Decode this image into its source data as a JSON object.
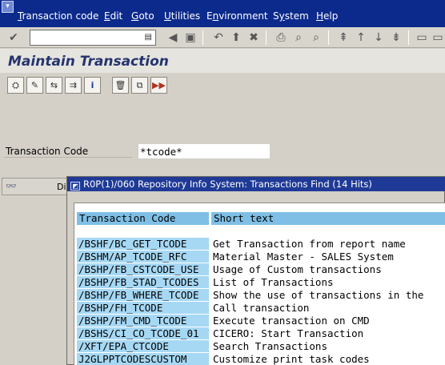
{
  "menu": {
    "items": [
      {
        "label": "Transaction code",
        "ul": "T"
      },
      {
        "label": "Edit",
        "ul": "E"
      },
      {
        "label": "Goto",
        "ul": "G"
      },
      {
        "label": "Utilities",
        "ul": "U"
      },
      {
        "label": "Environment",
        "ul": "n"
      },
      {
        "label": "System",
        "ul": "y"
      },
      {
        "label": "Help",
        "ul": "H"
      }
    ]
  },
  "toolbar": {
    "command_value": "",
    "buttons": [
      "enter-icon",
      "save-icon",
      "back-icon",
      "exit-icon",
      "cancel-icon",
      "print-icon",
      "find-icon",
      "find-next-icon",
      "first-page-icon",
      "prev-page-icon",
      "next-page-icon",
      "last-page-icon",
      "create-session-icon"
    ]
  },
  "title": "Maintain Transaction",
  "app_toolbar": [
    "display-icon",
    "change-icon",
    "variants-icon",
    "object-list-icon",
    "info-icon",
    "delete-icon",
    "copy-icon",
    "other-object-icon"
  ],
  "field": {
    "label": "Transaction Code",
    "value": "*tcode*"
  },
  "left_tab": {
    "label": "Di"
  },
  "popup": {
    "title": "R0P(1)/060 Repository Info System: Transactions Find (14 Hits)",
    "headers": [
      "Transaction Code",
      "Short text"
    ],
    "rows": [
      {
        "code": "/BSHF/BC_GET_TCODE",
        "text": "Get Transaction from report name"
      },
      {
        "code": "/BSHM/AP_TCODE_RFC",
        "text": "Material Master - SALES System"
      },
      {
        "code": "/BSHP/FB_CSTCODE_USE",
        "text": "Usage  of  Custom transactions"
      },
      {
        "code": "/BSHP/FB_STAD_TCODES",
        "text": "List of Transactions"
      },
      {
        "code": "/BSHP/FB_WHERE_TCODE",
        "text": "Show the use of transactions in the"
      },
      {
        "code": "/BSHP/FH_TCODE",
        "text": "Call transaction"
      },
      {
        "code": "/BSHP/FM_CMD_TCODE",
        "text": "Execute transaction on CMD"
      },
      {
        "code": "/BSHS/CI_CO_TCODE_01",
        "text": "CICERO: Start Transaction"
      },
      {
        "code": "/XFT/EPA_CTCODE",
        "text": "Search Transactions"
      },
      {
        "code": "J2GLPPTCODESCUSTOM",
        "text": "Customize print task codes"
      }
    ]
  }
}
